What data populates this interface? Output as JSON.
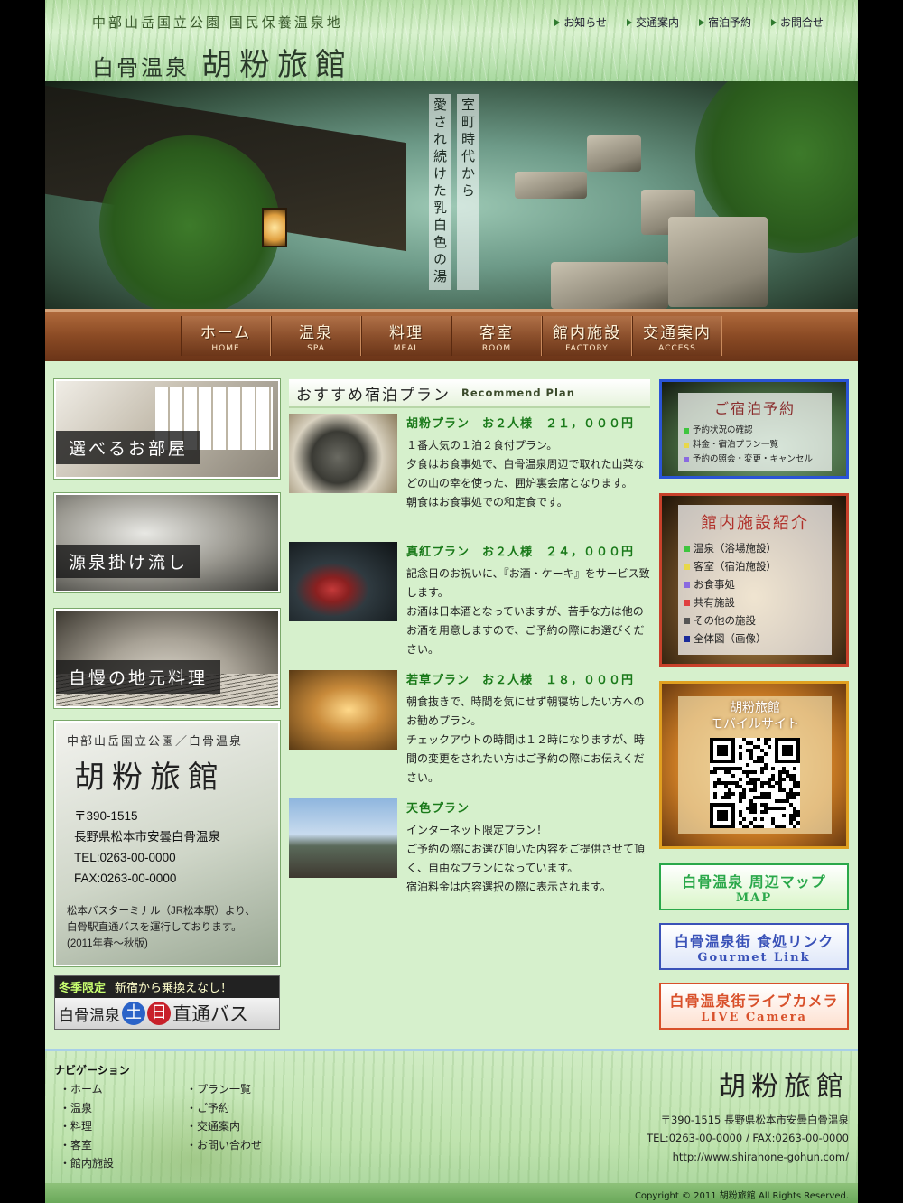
{
  "header": {
    "tagline": "中部山岳国立公園 国民保養温泉地",
    "title_pre": "白骨温泉",
    "title_main": "胡粉旅館",
    "links": [
      "お知らせ",
      "交通案内",
      "宿泊予約",
      "お問合せ"
    ]
  },
  "hero": {
    "copy_right": "室町時代から",
    "copy_left": "愛され続けた乳白色の湯"
  },
  "nav": [
    {
      "jp": "ホーム",
      "en": "HOME"
    },
    {
      "jp": "温泉",
      "en": "SPA"
    },
    {
      "jp": "料理",
      "en": "MEAL"
    },
    {
      "jp": "客室",
      "en": "ROOM"
    },
    {
      "jp": "館内施設",
      "en": "FACTORY"
    },
    {
      "jp": "交通案内",
      "en": "ACCESS"
    }
  ],
  "left": {
    "banners": [
      "選べるお部屋",
      "源泉掛け流し",
      "自慢の地元料理"
    ],
    "info": {
      "tag": "中部山岳国立公園／白骨温泉",
      "name": "胡粉旅館",
      "zip": "〒390-1515",
      "address": "長野県松本市安曇白骨温泉",
      "tel": "TEL:0263-00-0000",
      "fax": "FAX:0263-00-0000",
      "note1": "松本バスターミナル（JR松本駅）より、",
      "note2": "白骨駅直通バスを運行しております。",
      "note3": "(2011年春～秋版)"
    },
    "bus": {
      "season": "冬季限定",
      "sub": "新宿から乗換えなし！",
      "onsen": "白骨温泉",
      "sat": "土",
      "sun": "日",
      "direct": "直通バス"
    }
  },
  "plans": {
    "heading_jp": "おすすめ宿泊プラン",
    "heading_en": "Recommend Plan",
    "items": [
      {
        "title": "胡粉プラン　お２人様　２１，０００円",
        "lines": [
          "１番人気の１泊２食付プラン。",
          "夕食はお食事処で、白骨温泉周辺で取れた山菜などの山の幸を使った、囲炉裏会席となります。",
          "朝食はお食事処での和定食です。"
        ]
      },
      {
        "title": "真紅プラン　お２人様　２４，０００円",
        "lines": [
          "記念日のお祝いに、『お酒・ケーキ』をサービス致します。",
          "お酒は日本酒となっていますが、苦手な方は他のお酒を用意しますので、ご予約の際にお選びください。"
        ]
      },
      {
        "title": "若草プラン　お２人様　１８，０００円",
        "lines": [
          "朝食抜きで、時間を気にせず朝寝坊したい方へのお勧めプラン。",
          "チェックアウトの時間は１２時になりますが、時間の変更をされたい方はご予約の際にお伝えください。"
        ]
      },
      {
        "title": "天色プラン",
        "lines": [
          "インターネット限定プラン！",
          "ご予約の際にお選び頂いた内容をご提供させて頂く、自由なプランになっています。",
          "宿泊料金は内容選択の際に表示されます。"
        ]
      }
    ]
  },
  "right": {
    "reserve": {
      "title": "ご宿泊予約",
      "items": [
        {
          "label": "予約状況の確認",
          "color": "#3ec53e"
        },
        {
          "label": "料金・宿泊プラン一覧",
          "color": "#e8d84a"
        },
        {
          "label": "予約の照会・変更・キャンセル",
          "color": "#8a6ae0"
        }
      ]
    },
    "facility": {
      "title": "館内施設紹介",
      "items": [
        {
          "label": "温泉（浴場施設）",
          "color": "#3ec53e"
        },
        {
          "label": "客室（宿泊施設）",
          "color": "#e8d84a"
        },
        {
          "label": "お食事処",
          "color": "#8a6ae0"
        },
        {
          "label": "共有施設",
          "color": "#e04040"
        },
        {
          "label": "その他の施設",
          "color": "#555555"
        },
        {
          "label": "全体図（画像）",
          "color": "#1a2a9a"
        }
      ]
    },
    "mobile": {
      "title": "胡粉旅館",
      "sub": "モバイルサイト"
    },
    "links": {
      "map_jp": "白骨温泉 周辺マップ",
      "map_en": "MAP",
      "gourmet_jp": "白骨温泉街 食処リンク",
      "gourmet_en": "Gourmet Link",
      "camera_jp": "白骨温泉街ライブカメラ",
      "camera_en": "LIVE Camera"
    }
  },
  "footer": {
    "nav_title": "ナビゲーション",
    "nav_col1": [
      "・ホーム",
      "・温泉",
      "・料理",
      "・客室",
      "・館内施設"
    ],
    "nav_col2": [
      "・プラン一覧",
      "・ご予約",
      "・交通案内",
      "・お問い合わせ"
    ],
    "logo": "胡粉旅館",
    "address": "〒390-1515 長野県松本市安曇白骨温泉",
    "tel": "TEL:0263-00-0000 / FAX:0263-00-0000",
    "url": "http://www.shirahone-gohun.com/",
    "copyright": "Copyright © 2011 胡粉旅館 All Rights Reserved."
  }
}
